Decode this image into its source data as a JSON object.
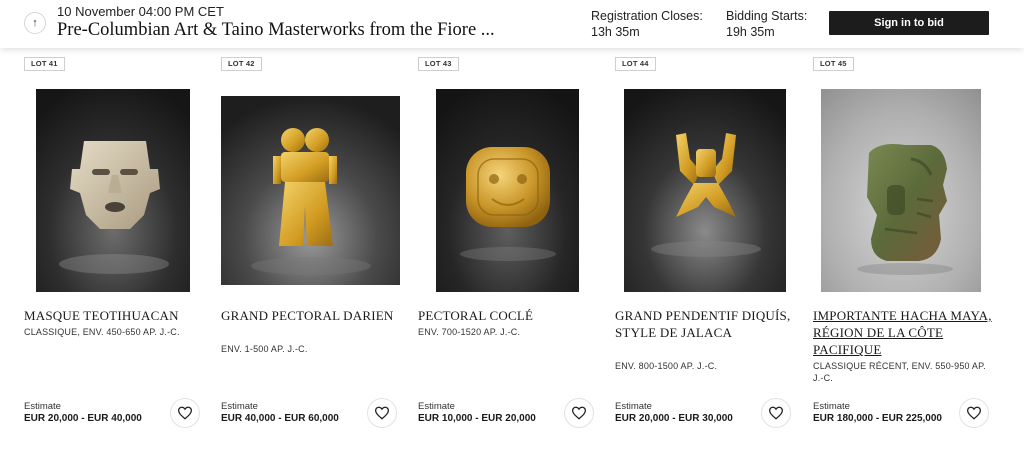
{
  "header": {
    "sale_date": "10 November 04:00 PM CET",
    "sale_title": "Pre-Columbian Art & Taino Masterworks from the Fiore ...",
    "registration_label": "Registration Closes:",
    "registration_value": "13h 35m",
    "bidding_label": "Bidding Starts:",
    "bidding_value": "19h 35m",
    "signin_label": "Sign in to bid",
    "up_icon": "arrow-up-icon"
  },
  "estimate_label": "Estimate",
  "lots": [
    {
      "badge": "LOT 41",
      "title": "MASQUE TEOTIHUACAN",
      "subtitle": "CLASSIQUE, ENV. 450-650 AP. J.-C.",
      "estimate": "EUR 20,000 - EUR 40,000",
      "image": "stone-mask"
    },
    {
      "badge": "LOT 42",
      "title": "GRAND PECTORAL DARIEN",
      "subtitle": "ENV. 1-500 AP. J.-C.",
      "estimate": "EUR 40,000 - EUR 60,000",
      "image": "gold-darien-pectoral"
    },
    {
      "badge": "LOT 43",
      "title": "PECTORAL COCLÉ",
      "subtitle": "ENV. 700-1520 AP. J.-C.",
      "estimate": "EUR 10,000 - EUR 20,000",
      "image": "gold-round-pectoral"
    },
    {
      "badge": "LOT 44",
      "title": "GRAND PENDENTIF DIQUÍS, STYLE DE JALACA",
      "subtitle": "ENV. 800-1500 AP. J.-C.",
      "estimate": "EUR 20,000 - EUR 30,000",
      "image": "gold-bird-pendant"
    },
    {
      "badge": "LOT 45",
      "title": "IMPORTANTE HACHA MAYA, RÉGION DE LA CÔTE PACIFIQUE",
      "subtitle": "CLASSIQUE RÉCENT, ENV. 550-950 AP. J.-C.",
      "estimate": "EUR 180,000 - EUR 225,000",
      "image": "green-stone-hacha"
    }
  ],
  "colors": {
    "button_dark": "#1c1c1c",
    "gold": "#d9a72e",
    "photo_dark": "#1e1e1e"
  }
}
